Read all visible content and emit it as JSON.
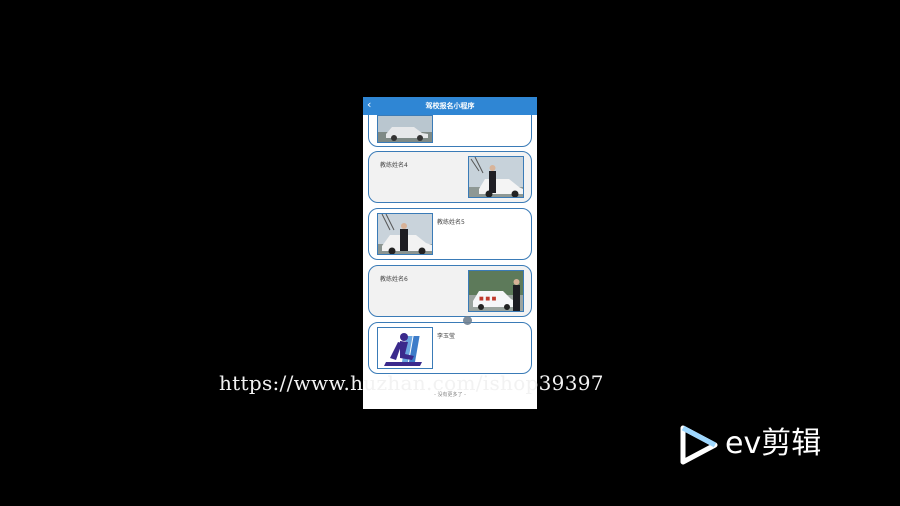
{
  "app": {
    "title": "驾校报名小程序",
    "back_icon": "chevron-left-icon",
    "nav_color": "#2f86d4"
  },
  "coaches": [
    {
      "name": "",
      "photo": "car-photo"
    },
    {
      "name": "教练姓名4",
      "photo": "coach-with-car-photo"
    },
    {
      "name": "教练姓名5",
      "photo": "coach-with-car-photo"
    },
    {
      "name": "教练姓名6",
      "photo": "coach-with-white-car-photo"
    },
    {
      "name": "李玉莹",
      "photo": "driving-school-logo"
    }
  ],
  "list_end_text": "- 没有更多了 -",
  "watermark": "https://www.huzhan.com/ishop39397",
  "editor_brand": "ev剪辑"
}
